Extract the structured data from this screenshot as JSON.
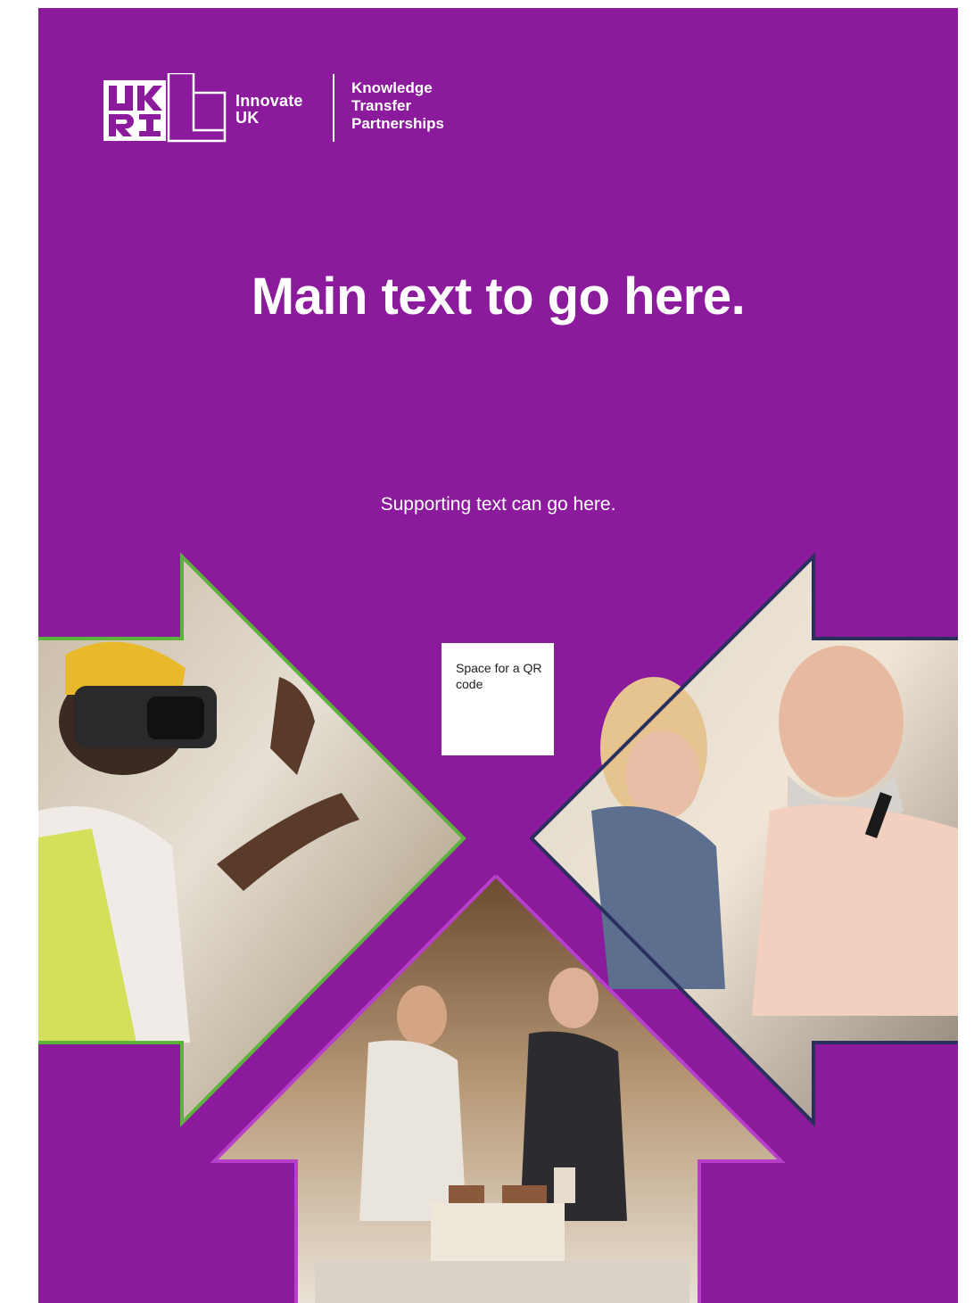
{
  "brand": {
    "logo_mark_letters": "UKRI",
    "innovate_line1": "Innovate",
    "innovate_line2": "UK",
    "ktp_line1": "Knowledge",
    "ktp_line2": "Transfer",
    "ktp_line3": "Partnerships"
  },
  "main_title": "Main text to go here.",
  "supporting_text": "Supporting text can go here.",
  "qr_placeholder": {
    "label": "Space for a QR code"
  },
  "photos": [
    {
      "name": "vr-headset-worker-photo",
      "accent": "#5cb33c"
    },
    {
      "name": "team-discussion-photo",
      "accent": "#2b2f5e"
    },
    {
      "name": "architects-model-photo",
      "accent": "#b83fc9"
    }
  ],
  "colors": {
    "background": "#8b1a9c",
    "green_accent": "#5cb33c",
    "navy_accent": "#2b2f5e",
    "magenta_accent": "#b83fc9",
    "text": "#ffffff"
  }
}
